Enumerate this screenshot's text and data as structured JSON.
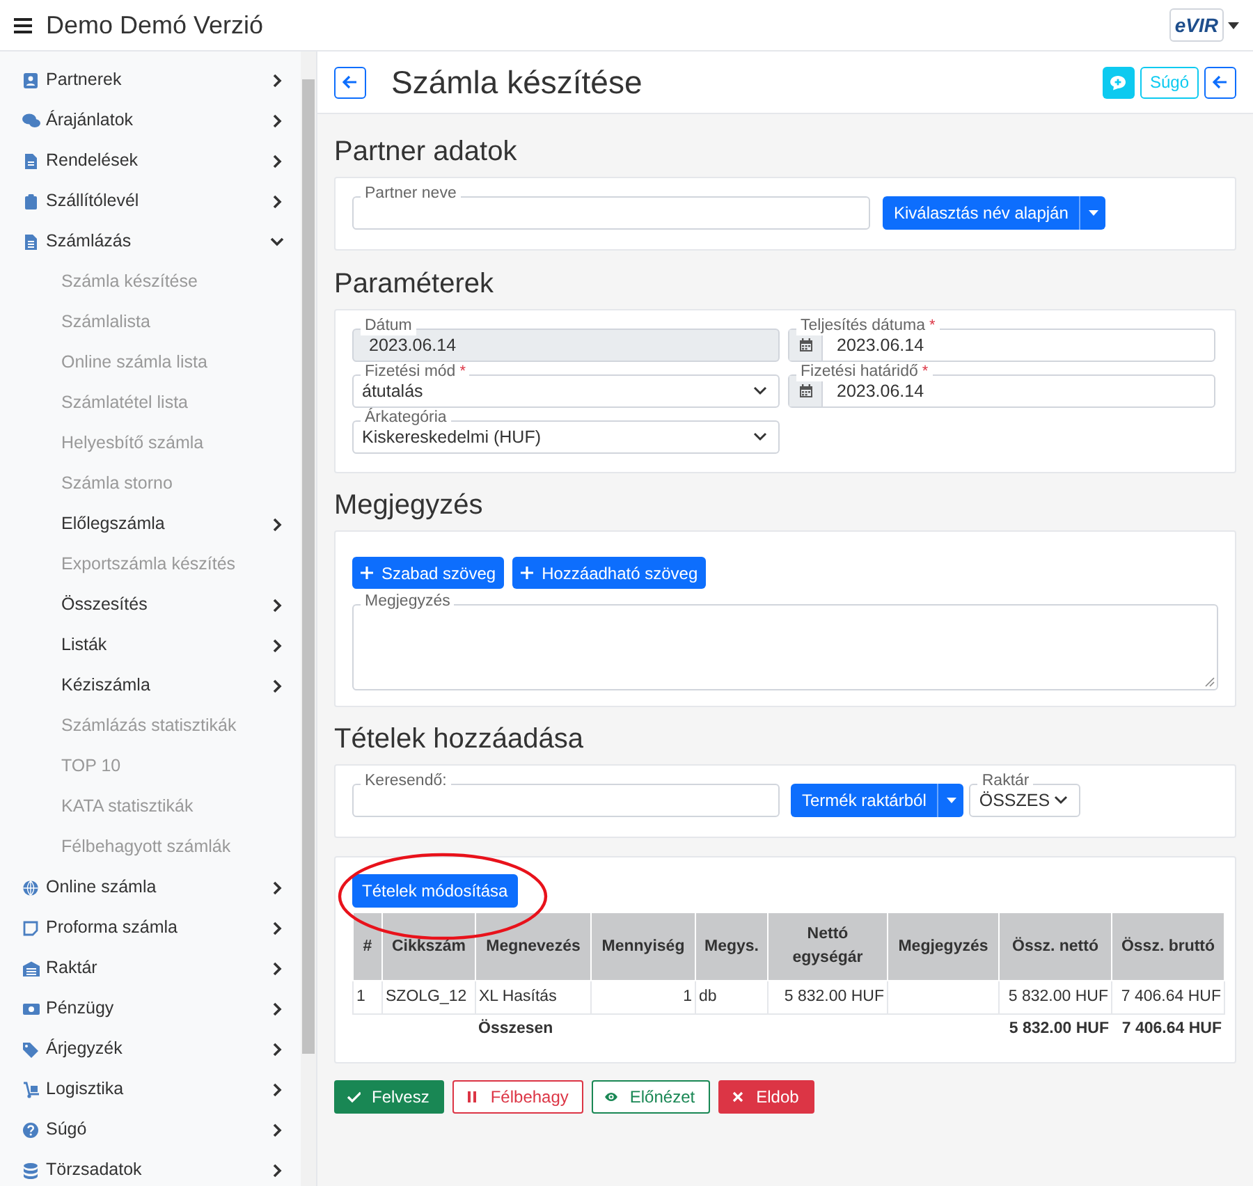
{
  "app": {
    "title": "Demo Demó Verzió",
    "logo": "eVIR"
  },
  "sidebar": {
    "items": [
      {
        "label": "Partnerek",
        "kind": "section",
        "expanded": false
      },
      {
        "label": "Árajánlatok",
        "kind": "section",
        "expanded": false
      },
      {
        "label": "Rendelések",
        "kind": "section",
        "expanded": false
      },
      {
        "label": "Szállítólevél",
        "kind": "section",
        "expanded": false
      },
      {
        "label": "Számlázás",
        "kind": "section",
        "expanded": true
      },
      {
        "label": "Számla készítése",
        "kind": "link"
      },
      {
        "label": "Számlalista",
        "kind": "link"
      },
      {
        "label": "Online számla lista",
        "kind": "link"
      },
      {
        "label": "Számlatétel lista",
        "kind": "link"
      },
      {
        "label": "Helyesbítő számla",
        "kind": "link"
      },
      {
        "label": "Számla storno",
        "kind": "link"
      },
      {
        "label": "Előlegszámla",
        "kind": "group"
      },
      {
        "label": "Exportszámla készítés",
        "kind": "link"
      },
      {
        "label": "Összesítés",
        "kind": "group"
      },
      {
        "label": "Listák",
        "kind": "group"
      },
      {
        "label": "Kéziszámla",
        "kind": "group"
      },
      {
        "label": "Számlázás statisztikák",
        "kind": "link"
      },
      {
        "label": "TOP 10",
        "kind": "link"
      },
      {
        "label": "KATA statisztikák",
        "kind": "link"
      },
      {
        "label": "Félbehagyott számlák",
        "kind": "link"
      },
      {
        "label": "Online számla",
        "kind": "section",
        "expanded": false
      },
      {
        "label": "Proforma számla",
        "kind": "section",
        "expanded": false
      },
      {
        "label": "Raktár",
        "kind": "section",
        "expanded": false
      },
      {
        "label": "Pénzügy",
        "kind": "section",
        "expanded": false
      },
      {
        "label": "Árjegyzék",
        "kind": "section",
        "expanded": false
      },
      {
        "label": "Logisztika",
        "kind": "section",
        "expanded": false
      },
      {
        "label": "Súgó",
        "kind": "section",
        "expanded": false
      },
      {
        "label": "Törzsadatok",
        "kind": "section",
        "expanded": false
      }
    ]
  },
  "page": {
    "title": "Számla készítése",
    "help_button": "Súgó"
  },
  "partner": {
    "heading": "Partner adatok",
    "field": {
      "label": "Partner neve"
    },
    "select_button": "Kiválasztás név alapján"
  },
  "parameters": {
    "heading": "Paraméterek",
    "fields": [
      {
        "label": "Dátum",
        "value": "2023.06.14",
        "kind": "text",
        "disabled": true
      },
      {
        "label": "Teljesítés dátuma",
        "required_mark": "*",
        "value": "2023.06.14",
        "kind": "date",
        "disabled": false
      },
      {
        "label": "Fizetési mód",
        "required_mark": "*",
        "value": "átutalás",
        "kind": "select",
        "disabled": false
      },
      {
        "label": "Fizetési határidő",
        "required_mark": "*",
        "value": "2023.06.14",
        "kind": "date",
        "disabled": false
      },
      {
        "label": "Árkategória",
        "value": "Kiskereskedelmi (HUF)",
        "kind": "select",
        "disabled": false
      }
    ]
  },
  "note": {
    "heading": "Megjegyzés",
    "buttons": [
      "Szabad szöveg",
      "Hozzáadható szöveg"
    ],
    "field": {
      "label": "Megjegyzés"
    }
  },
  "items_add": {
    "heading": "Tételek hozzáadása",
    "search": {
      "label": "Keresendő:"
    },
    "product_button": "Termék raktárból",
    "warehouse": {
      "label": "Raktár",
      "value": "ÖSSZES"
    }
  },
  "items": {
    "edit_button": "Tételek módosítása",
    "columns": [
      "#",
      "Cikkszám",
      "Megnevezés",
      "Mennyiség",
      "Megys.",
      "Nettó egységár",
      "Megjegyzés",
      "Össz. nettó",
      "Össz. bruttó"
    ],
    "rows": [
      [
        "1",
        "SZOLG_12",
        "XL Hasítás",
        "1",
        "db",
        "5 832.00 HUF",
        "",
        "5 832.00 HUF",
        "7 406.64 HUF"
      ]
    ],
    "total": {
      "label": "Összesen",
      "net": "5 832.00 HUF",
      "gross": "7 406.64 HUF"
    }
  },
  "actions": [
    {
      "label": "Felvesz",
      "kind": "save"
    },
    {
      "label": "Félbehagy",
      "kind": "pause"
    },
    {
      "label": "Előnézet",
      "kind": "preview"
    },
    {
      "label": "Eldob",
      "kind": "discard"
    }
  ]
}
